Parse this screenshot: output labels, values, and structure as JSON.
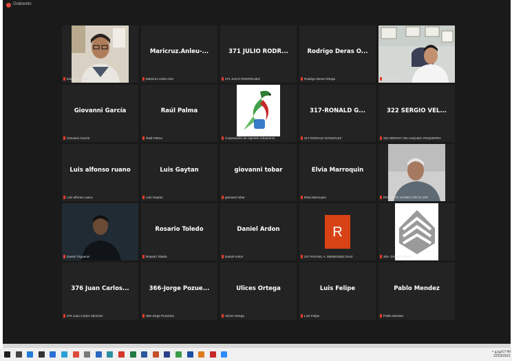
{
  "window": {
    "recording_label": "Grabando"
  },
  "tiles": [
    {
      "name": "",
      "label": "Eduardo Beltrán",
      "kind": "video-man-glasses"
    },
    {
      "name": "Maricruz.Anleu-...",
      "label": "Maricruz.Anleu-333",
      "kind": "name"
    },
    {
      "name": "371 JULIO RODR...",
      "label": "371 JULIO RODRIGUEZ",
      "kind": "name"
    },
    {
      "name": "Rodrigo Deras O...",
      "label": "Rodrigo Deras Ortega",
      "kind": "name"
    },
    {
      "name": "",
      "label": "Jorge Zibara",
      "kind": "video-man-office"
    },
    {
      "name": "Giovanni García",
      "label": "Giovanni García",
      "kind": "name"
    },
    {
      "name": "Raúl Palma",
      "label": "Raúl Palma",
      "kind": "name"
    },
    {
      "name": "",
      "label": "Corporación de Agentes Aduaneros",
      "kind": "logo-bird"
    },
    {
      "name": "317-RONALD G...",
      "label": "317-RONALD GONZÁLEZ",
      "kind": "name"
    },
    {
      "name": "322 SERGIO VEL...",
      "label": "322 SERGIO VELASQUEZ VISQUERRA",
      "kind": "name"
    },
    {
      "name": "Luis alfonso ruano",
      "label": "Luis alfonso ruano",
      "kind": "name"
    },
    {
      "name": "Luis Gaytan",
      "label": "Luis Gaytan",
      "kind": "name"
    },
    {
      "name": "giovanni tobar",
      "label": "giovanni tobar",
      "kind": "name"
    },
    {
      "name": "Elvia Marroquin",
      "label": "Elvia Marroquin",
      "kind": "name"
    },
    {
      "name": "",
      "label": "ROBERTO GOMEZ ORTIZ 260",
      "kind": "video-man-gray"
    },
    {
      "name": "",
      "label": "Daniel Trigueros",
      "kind": "video-man-dark"
    },
    {
      "name": "Rosario Toledo",
      "label": "Rosario Toledo",
      "kind": "name"
    },
    {
      "name": "Daniel  Ardon",
      "label": "Daniel  Ardon",
      "kind": "name"
    },
    {
      "name": "",
      "label": "247 RAFAEL A. MENENDEZ DIAZ",
      "kind": "avatar-r",
      "avatar_letter": "R"
    },
    {
      "name": "",
      "label": "304- DAVID LOSAS",
      "kind": "logo-house"
    },
    {
      "name": "376 Juan Carlos...",
      "label": "376 Juan Carlos Sánchez",
      "kind": "name"
    },
    {
      "name": "366-Jorge Pozue...",
      "label": "366-Jorge Pozuelos",
      "kind": "name"
    },
    {
      "name": "Ulices Ortega",
      "label": "Ulices Ortega",
      "kind": "name"
    },
    {
      "name": "Luis Felipe",
      "label": "Luis Felipe",
      "kind": "name"
    },
    {
      "name": "Pablo Mendez",
      "label": "Pablo Mendez",
      "kind": "name"
    }
  ],
  "taskbar": {
    "icons": [
      {
        "name": "windows-start-icon",
        "color": "#1e1e1e"
      },
      {
        "name": "search-icon",
        "color": "#444444"
      },
      {
        "name": "edge-icon",
        "color": "#1f7cd6"
      },
      {
        "name": "task-view-icon",
        "color": "#333333"
      },
      {
        "name": "store-icon",
        "color": "#2b6fd6"
      },
      {
        "name": "photos-icon",
        "color": "#2aa0d8"
      },
      {
        "name": "app-red-icon",
        "color": "#e04a3b"
      },
      {
        "name": "app-gray-icon",
        "color": "#7a7a7a"
      },
      {
        "name": "app-blue-icon",
        "color": "#2b66c0"
      },
      {
        "name": "app-teal-icon",
        "color": "#2a8fa0"
      },
      {
        "name": "acrobat-icon",
        "color": "#d4372a"
      },
      {
        "name": "excel-icon",
        "color": "#1f7a44"
      },
      {
        "name": "word-icon",
        "color": "#2b579a"
      },
      {
        "name": "powerpoint-icon",
        "color": "#c4502b"
      },
      {
        "name": "app-navy-icon",
        "color": "#2b3f8a"
      },
      {
        "name": "chrome-icon",
        "color": "#3b9a4a"
      },
      {
        "name": "app-darkblue-icon",
        "color": "#1e4fa0"
      },
      {
        "name": "app-orange-icon",
        "color": "#e07a1f"
      },
      {
        "name": "app-red2-icon",
        "color": "#c62828"
      },
      {
        "name": "zoom-icon",
        "color": "#2d8cff"
      }
    ],
    "tray_text": "^ ESP",
    "time": "17:49",
    "date": "22/03/2021"
  }
}
